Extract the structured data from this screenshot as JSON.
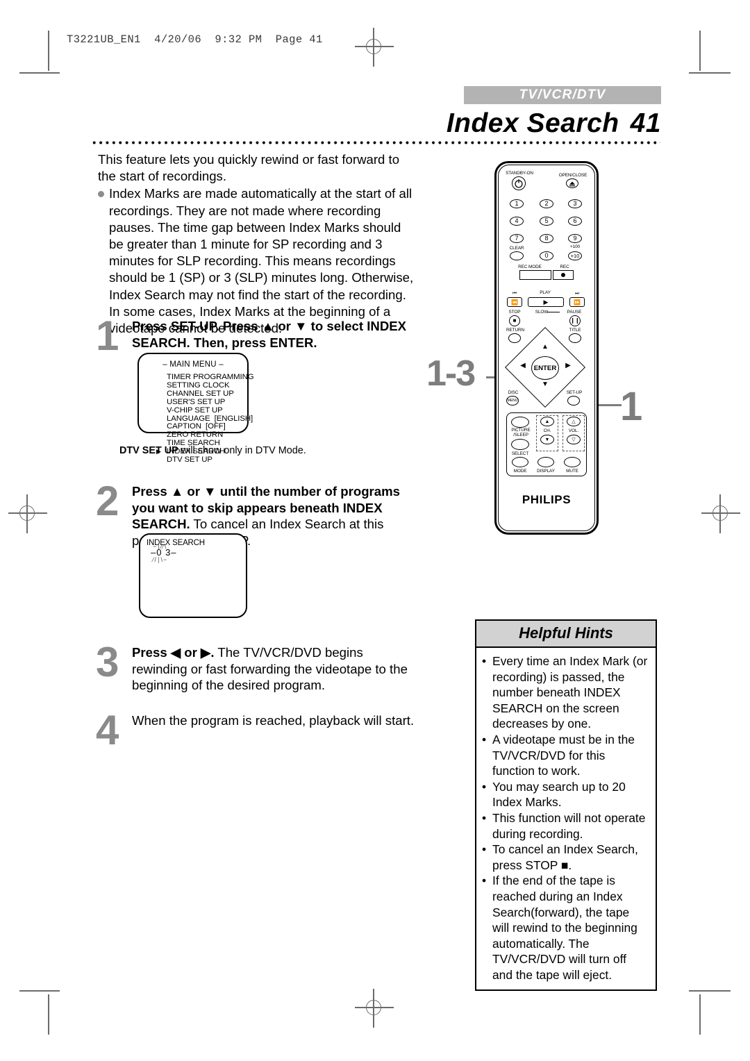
{
  "document": {
    "file_header": "T3221UB_EN1  4/20/06  9:32 PM  Page 41",
    "banner": "TV/VCR/DTV",
    "title": "Index Search",
    "page_number": "41"
  },
  "intro": {
    "lead": "This feature lets you quickly rewind or fast forward to the start of recordings.",
    "bullet": "Index Marks are made automatically at the start of all recordings. They are not made where recording pauses. The time gap between Index Marks should be greater than 1 minute for SP recording and 3 minutes for SLP recording. This means recordings should be 1 (SP) or 3 (SLP) minutes long. Otherwise, Index Search may not find the start of the recording. In some cases, Index Marks at the beginning of a videotape cannot be detected."
  },
  "steps": {
    "one": {
      "number": "1",
      "bold": "Press SET-UP. Press ▲ or ▼ to select INDEX SEARCH. Then, press ENTER.",
      "note_bold": "DTV SET UP",
      "note_rest": " will show only in DTV Mode."
    },
    "two": {
      "number": "2",
      "bold": "Press ▲ or ▼ until the number of programs you want to skip appears beneath INDEX SEARCH.",
      "plain": "To cancel an Index Search at this point, press SET-UP."
    },
    "three": {
      "number": "3",
      "bold": "Press ◀ or ▶.",
      "plain": " The TV/VCR/DVD begins rewinding or fast forwarding the videotape to the beginning of the desired program."
    },
    "four": {
      "number": "4",
      "plain": "When the program is reached, playback will start."
    }
  },
  "osd_main_menu": {
    "title": "– MAIN MENU –",
    "items": [
      "TIMER PROGRAMMING",
      "SETTING CLOCK",
      "CHANNEL SET UP",
      "USER'S SET UP",
      "V-CHIP SET UP",
      "LANGUAGE  [ENGLISH]",
      "CAPTION  [OFF]",
      "ZERO RETURN",
      "TIME SEARCH",
      "INDEX SEARCH",
      "DTV SET UP"
    ],
    "selected_index": 9
  },
  "osd_index_search": {
    "label": "INDEX SEARCH",
    "value": "–0 3–"
  },
  "hints": {
    "title": "Helpful Hints",
    "items": [
      "Every time an Index Mark (or recording) is passed, the number beneath INDEX SEARCH on the screen decreases by one.",
      "A videotape must be in the TV/VCR/DVD for this function to work.",
      "You may search up to 20 Index Marks.",
      "This function will not operate during recording.",
      "To cancel an Index Search, press STOP ■.",
      "If the end of the tape is reached during an Index Search(forward), the tape will rewind to the beginning automatically. The TV/VCR/DVD will turn off and the tape will eject."
    ]
  },
  "callouts": {
    "nav_pad": "1-3",
    "setup_button": "1"
  },
  "remote": {
    "brand": "PHILIPS",
    "labels": {
      "standby": "STANDBY-ON",
      "open_close": "OPEN/CLOSE",
      "clear": "CLEAR",
      "plus100": "+100",
      "plus10": "+10",
      "rec_mode": "REC MODE",
      "rec": "REC",
      "play": "PLAY",
      "stop": "STOP",
      "slow": "SLOW",
      "pause": "PAUSE",
      "return": "RETURN",
      "title": "TITLE",
      "enter": "ENTER",
      "disc_menu": "DISC",
      "disc_menu2": "MENU",
      "setup": "SET-UP",
      "picture": "PICTURE",
      "sleep": "/SLEEP",
      "select": "SELECT",
      "ch": "CH.",
      "vol": "VOL.",
      "mode": "MODE",
      "display": "DISPLAY",
      "mute": "MUTE"
    },
    "numbers": [
      "1",
      "2",
      "3",
      "4",
      "5",
      "6",
      "7",
      "8",
      "9",
      "0"
    ]
  },
  "colors": {
    "banner_bg": "#b3b3b3",
    "step_number": "#8a8a8a",
    "hints_header_bg": "#d2d2d2",
    "callout": "#7d7d7d"
  }
}
